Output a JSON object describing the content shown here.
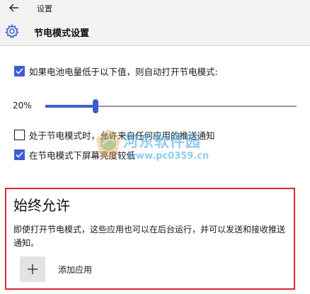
{
  "window": {
    "title": "设置"
  },
  "header": {
    "title": "节电模式设置"
  },
  "auto_saver": {
    "label": "如果电池电量低于以下值，则自动打开节电模式:",
    "checked": true,
    "threshold_text": "20%",
    "threshold_percent": 20
  },
  "options": [
    {
      "label": "处于节电模式时，允许来自任何应用的推送通知",
      "checked": false
    },
    {
      "label": "在节电模式下屏幕亮度较低",
      "checked": true
    }
  ],
  "always_allowed": {
    "title": "始终允许",
    "description": "即使打开节电模式，这些应用也可以在后台运行，并可以发送和接收推送通知。",
    "add_button_label": "添加应用",
    "add_icon": "plus-icon"
  },
  "watermark": {
    "text": "河东软件园",
    "url": "www.pc0359.cn"
  },
  "colors": {
    "accent": "#3a5fd0",
    "highlight_border": "#e0262c",
    "chrome": "#f2f2f2"
  }
}
